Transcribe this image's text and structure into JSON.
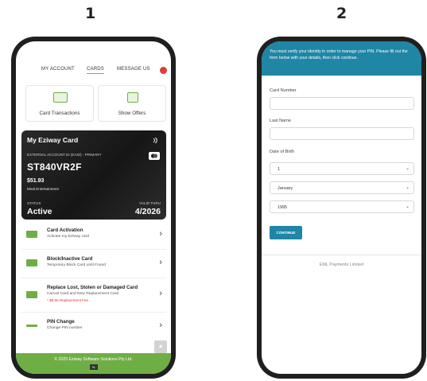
{
  "panels": {
    "left_number": "1",
    "right_number": "2"
  },
  "screen1": {
    "tabs": {
      "account": "MY ACCOUNT",
      "cards": "CARDS",
      "message": "MESSAGE US"
    },
    "quick": {
      "transactions": "Card Transactions",
      "offers": "Show Offers"
    },
    "card": {
      "title": "My Eziway Card",
      "account_label": "EXTERNAL ACCOUNT ID (EAID) - PRIMARY",
      "account_id": "ST840VR2F",
      "balance": "$51.93",
      "balance_label": "Meal Entertainment",
      "status_label": "STATUS",
      "status": "Active",
      "valid_label": "VALID THRU",
      "valid": "4/2026"
    },
    "items": [
      {
        "title": "Card Activation",
        "subtitle": "Activate my Eziway card",
        "fee": ""
      },
      {
        "title": "Block/Inactive Card",
        "subtitle": "Temporary Block Card until Found",
        "fee": ""
      },
      {
        "title": "Replace Lost, Stolen or Damaged Card",
        "subtitle": "Cancel Card and New Replacement Card",
        "fee": "* $8.80 Replacement Fee"
      },
      {
        "title": "PIN Change",
        "subtitle": "Change PIN number",
        "fee": ""
      }
    ],
    "footer": "© 2025 Eziway Software Solutions Pty Ltd.",
    "footer_badge": "%"
  },
  "screen2": {
    "banner": "You must verify your identity in order to manage your PIN. Please fill out the form below with your details, then click continue.",
    "card_number_label": "Card Number",
    "card_number_value": "",
    "last_name_label": "Last Name",
    "last_name_value": "",
    "dob_label": "Date of Birth",
    "day": "1",
    "month": "January",
    "year": "1995",
    "continue_label": "CONTINUE",
    "company": "EML Payments Limited"
  },
  "colors": {
    "brand_green": "#6fae45",
    "brand_blue": "#1f86a6",
    "badge_red": "#e03a3a"
  },
  "icons": [
    "credit-card-icon",
    "gift-icon",
    "contactless-icon",
    "mastercard-icon",
    "card-action-icon",
    "chevron-right-icon",
    "chevron-down-icon",
    "arrow-up-icon"
  ]
}
